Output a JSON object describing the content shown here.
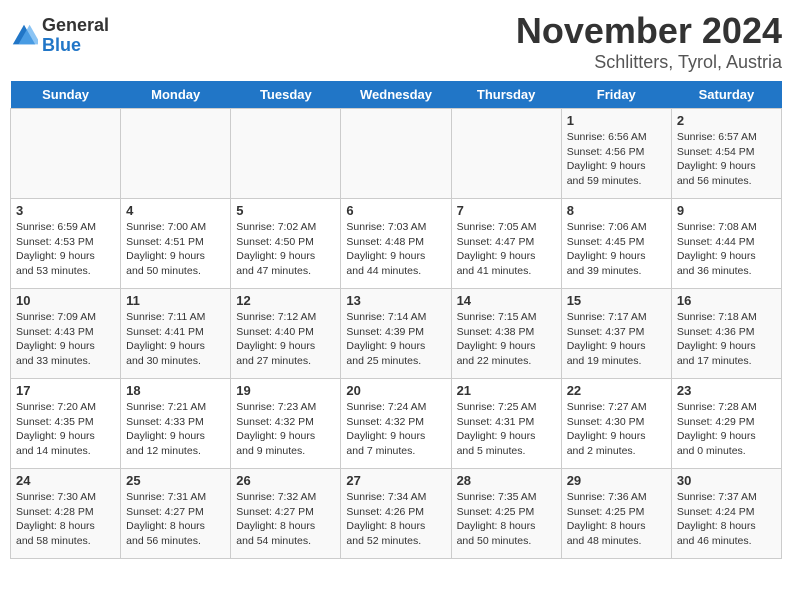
{
  "logo": {
    "general": "General",
    "blue": "Blue"
  },
  "title": "November 2024",
  "location": "Schlitters, Tyrol, Austria",
  "weekdays": [
    "Sunday",
    "Monday",
    "Tuesday",
    "Wednesday",
    "Thursday",
    "Friday",
    "Saturday"
  ],
  "weeks": [
    [
      {
        "day": "",
        "detail": ""
      },
      {
        "day": "",
        "detail": ""
      },
      {
        "day": "",
        "detail": ""
      },
      {
        "day": "",
        "detail": ""
      },
      {
        "day": "",
        "detail": ""
      },
      {
        "day": "1",
        "detail": "Sunrise: 6:56 AM\nSunset: 4:56 PM\nDaylight: 9 hours\nand 59 minutes."
      },
      {
        "day": "2",
        "detail": "Sunrise: 6:57 AM\nSunset: 4:54 PM\nDaylight: 9 hours\nand 56 minutes."
      }
    ],
    [
      {
        "day": "3",
        "detail": "Sunrise: 6:59 AM\nSunset: 4:53 PM\nDaylight: 9 hours\nand 53 minutes."
      },
      {
        "day": "4",
        "detail": "Sunrise: 7:00 AM\nSunset: 4:51 PM\nDaylight: 9 hours\nand 50 minutes."
      },
      {
        "day": "5",
        "detail": "Sunrise: 7:02 AM\nSunset: 4:50 PM\nDaylight: 9 hours\nand 47 minutes."
      },
      {
        "day": "6",
        "detail": "Sunrise: 7:03 AM\nSunset: 4:48 PM\nDaylight: 9 hours\nand 44 minutes."
      },
      {
        "day": "7",
        "detail": "Sunrise: 7:05 AM\nSunset: 4:47 PM\nDaylight: 9 hours\nand 41 minutes."
      },
      {
        "day": "8",
        "detail": "Sunrise: 7:06 AM\nSunset: 4:45 PM\nDaylight: 9 hours\nand 39 minutes."
      },
      {
        "day": "9",
        "detail": "Sunrise: 7:08 AM\nSunset: 4:44 PM\nDaylight: 9 hours\nand 36 minutes."
      }
    ],
    [
      {
        "day": "10",
        "detail": "Sunrise: 7:09 AM\nSunset: 4:43 PM\nDaylight: 9 hours\nand 33 minutes."
      },
      {
        "day": "11",
        "detail": "Sunrise: 7:11 AM\nSunset: 4:41 PM\nDaylight: 9 hours\nand 30 minutes."
      },
      {
        "day": "12",
        "detail": "Sunrise: 7:12 AM\nSunset: 4:40 PM\nDaylight: 9 hours\nand 27 minutes."
      },
      {
        "day": "13",
        "detail": "Sunrise: 7:14 AM\nSunset: 4:39 PM\nDaylight: 9 hours\nand 25 minutes."
      },
      {
        "day": "14",
        "detail": "Sunrise: 7:15 AM\nSunset: 4:38 PM\nDaylight: 9 hours\nand 22 minutes."
      },
      {
        "day": "15",
        "detail": "Sunrise: 7:17 AM\nSunset: 4:37 PM\nDaylight: 9 hours\nand 19 minutes."
      },
      {
        "day": "16",
        "detail": "Sunrise: 7:18 AM\nSunset: 4:36 PM\nDaylight: 9 hours\nand 17 minutes."
      }
    ],
    [
      {
        "day": "17",
        "detail": "Sunrise: 7:20 AM\nSunset: 4:35 PM\nDaylight: 9 hours\nand 14 minutes."
      },
      {
        "day": "18",
        "detail": "Sunrise: 7:21 AM\nSunset: 4:33 PM\nDaylight: 9 hours\nand 12 minutes."
      },
      {
        "day": "19",
        "detail": "Sunrise: 7:23 AM\nSunset: 4:32 PM\nDaylight: 9 hours\nand 9 minutes."
      },
      {
        "day": "20",
        "detail": "Sunrise: 7:24 AM\nSunset: 4:32 PM\nDaylight: 9 hours\nand 7 minutes."
      },
      {
        "day": "21",
        "detail": "Sunrise: 7:25 AM\nSunset: 4:31 PM\nDaylight: 9 hours\nand 5 minutes."
      },
      {
        "day": "22",
        "detail": "Sunrise: 7:27 AM\nSunset: 4:30 PM\nDaylight: 9 hours\nand 2 minutes."
      },
      {
        "day": "23",
        "detail": "Sunrise: 7:28 AM\nSunset: 4:29 PM\nDaylight: 9 hours\nand 0 minutes."
      }
    ],
    [
      {
        "day": "24",
        "detail": "Sunrise: 7:30 AM\nSunset: 4:28 PM\nDaylight: 8 hours\nand 58 minutes."
      },
      {
        "day": "25",
        "detail": "Sunrise: 7:31 AM\nSunset: 4:27 PM\nDaylight: 8 hours\nand 56 minutes."
      },
      {
        "day": "26",
        "detail": "Sunrise: 7:32 AM\nSunset: 4:27 PM\nDaylight: 8 hours\nand 54 minutes."
      },
      {
        "day": "27",
        "detail": "Sunrise: 7:34 AM\nSunset: 4:26 PM\nDaylight: 8 hours\nand 52 minutes."
      },
      {
        "day": "28",
        "detail": "Sunrise: 7:35 AM\nSunset: 4:25 PM\nDaylight: 8 hours\nand 50 minutes."
      },
      {
        "day": "29",
        "detail": "Sunrise: 7:36 AM\nSunset: 4:25 PM\nDaylight: 8 hours\nand 48 minutes."
      },
      {
        "day": "30",
        "detail": "Sunrise: 7:37 AM\nSunset: 4:24 PM\nDaylight: 8 hours\nand 46 minutes."
      }
    ]
  ]
}
